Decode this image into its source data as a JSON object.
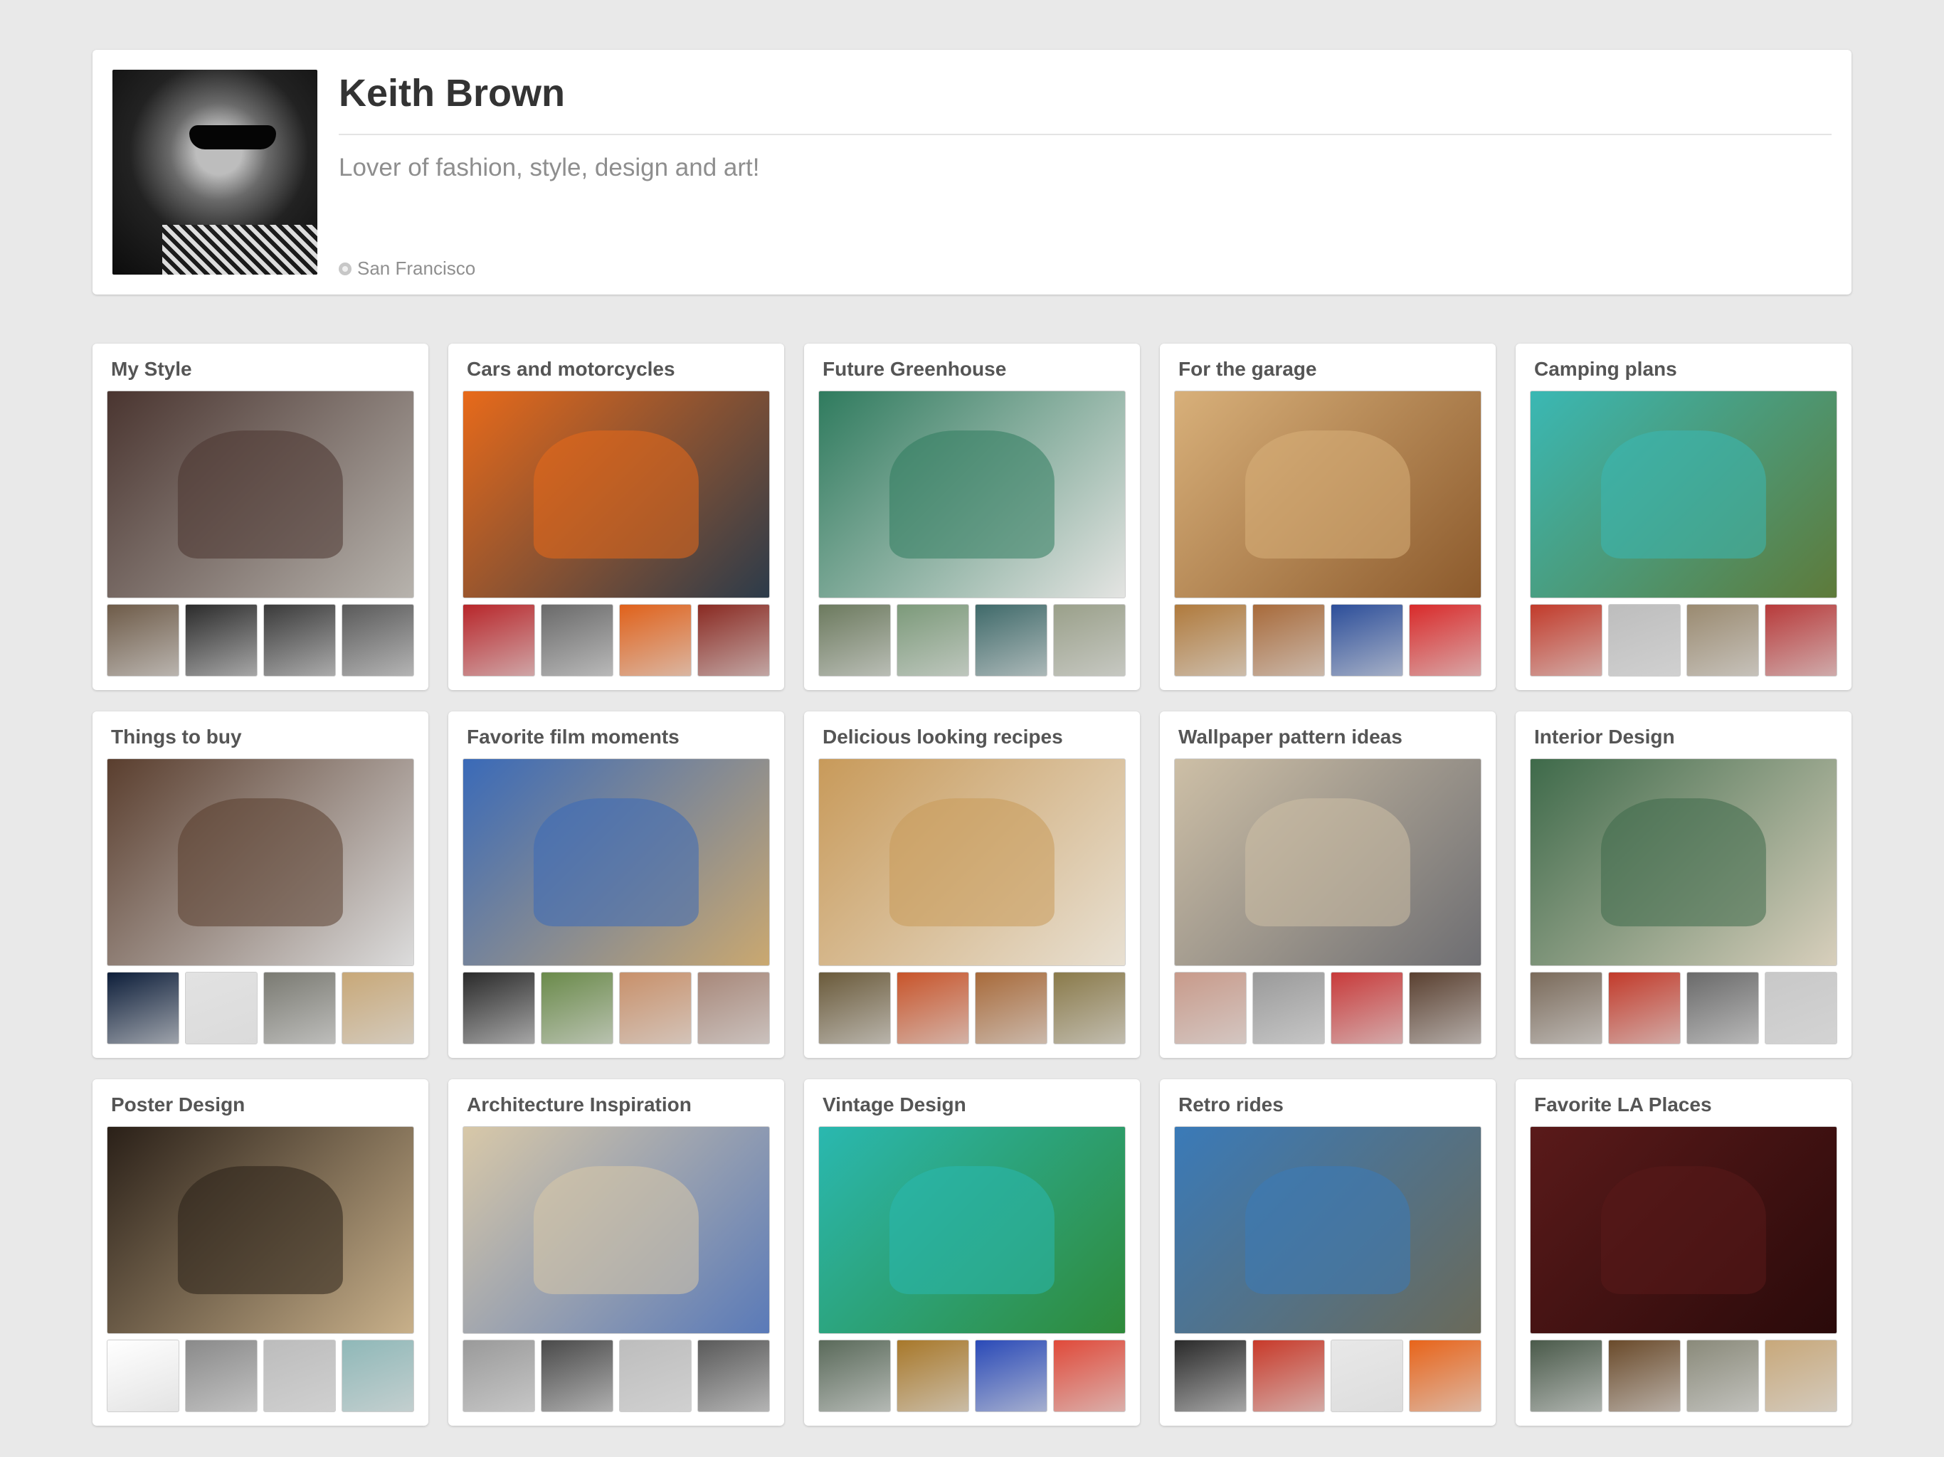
{
  "profile": {
    "name": "Keith Brown",
    "bio": "Lover of fashion, style, design and art!",
    "location": "San Francisco",
    "location_icon": "globe-icon"
  },
  "colors": {
    "page_background": "#e9e9e9",
    "card_background": "#ffffff",
    "title_text": "#333333",
    "muted_text": "#8e8e8e"
  },
  "boards": [
    {
      "title": "My Style",
      "cover_colors": [
        "#4a3530",
        "#b7b3ad"
      ],
      "thumbs": [
        "#6e5b48",
        "#2b2b2b",
        "#3a3a3a",
        "#5a5a5a"
      ]
    },
    {
      "title": "Cars and motorcycles",
      "cover_colors": [
        "#e86a1a",
        "#2c3b4a"
      ],
      "thumbs": [
        "#b8262a",
        "#6a6a6a",
        "#e0611a",
        "#8a2a22"
      ]
    },
    {
      "title": "Future Greenhouse",
      "cover_colors": [
        "#2f7b5e",
        "#e4e4e2"
      ],
      "thumbs": [
        "#6c7a5e",
        "#7c9a7a",
        "#3f6a6a",
        "#9aa08a"
      ]
    },
    {
      "title": "For the garage",
      "cover_colors": [
        "#d8b07a",
        "#8c5a2c"
      ],
      "thumbs": [
        "#b07a3c",
        "#a86a3a",
        "#2c4e9a",
        "#d92a2a"
      ]
    },
    {
      "title": "Camping plans",
      "cover_colors": [
        "#3ab8b4",
        "#5e7a3a"
      ],
      "thumbs": [
        "#c23a2a",
        "#bdbdbd",
        "#9a8a70",
        "#b83a3a"
      ]
    },
    {
      "title": "Things to buy",
      "cover_colors": [
        "#5a3e2e",
        "#dcdcdc"
      ],
      "thumbs": [
        "#0d1e3a",
        "#e2e2e2",
        "#7a7a72",
        "#c8a878"
      ]
    },
    {
      "title": "Favorite film moments",
      "cover_colors": [
        "#3a6ab8",
        "#caa870"
      ],
      "thumbs": [
        "#2a2a2a",
        "#6a8a4a",
        "#c8906a",
        "#a8887a"
      ]
    },
    {
      "title": "Delicious looking recipes",
      "cover_colors": [
        "#c89a5a",
        "#e8e0d2"
      ],
      "thumbs": [
        "#6a5a3a",
        "#c8542a",
        "#a86a3a",
        "#8a7a4a"
      ]
    },
    {
      "title": "Wallpaper pattern ideas",
      "cover_colors": [
        "#cdbfa6",
        "#6e6e72"
      ],
      "thumbs": [
        "#c89a8a",
        "#9a9a9a",
        "#c83a3a",
        "#5a4030"
      ]
    },
    {
      "title": "Interior Design",
      "cover_colors": [
        "#3e6a4a",
        "#d8cfbc"
      ],
      "thumbs": [
        "#7a6a5a",
        "#c23a2a",
        "#6a6a6a",
        "#c8c8c8"
      ]
    },
    {
      "title": "Poster Design",
      "cover_colors": [
        "#2a2018",
        "#c8b08a"
      ],
      "thumbs": [
        "#ffffff",
        "#8a8a8a",
        "#bcbcbc",
        "#8fb8b8"
      ]
    },
    {
      "title": "Architecture Inspiration",
      "cover_colors": [
        "#d8c8a8",
        "#5a7ab8"
      ],
      "thumbs": [
        "#9a9a9a",
        "#4a4a4a",
        "#bdbdbd",
        "#5a5a5a"
      ]
    },
    {
      "title": "Vintage Design",
      "cover_colors": [
        "#2ab8b0",
        "#2f8a3a"
      ],
      "thumbs": [
        "#5a6a5a",
        "#a8782a",
        "#2a4ab8",
        "#e04a3a"
      ]
    },
    {
      "title": "Retro rides",
      "cover_colors": [
        "#3a7ab8",
        "#6a6a5a"
      ],
      "thumbs": [
        "#2a2a2a",
        "#c83a2a",
        "#e8e8e8",
        "#e8641a"
      ]
    },
    {
      "title": "Favorite LA Places",
      "cover_colors": [
        "#5a1a1a",
        "#2a0a0a"
      ],
      "thumbs": [
        "#4a5a4a",
        "#6a4a2a",
        "#8a8a7a",
        "#c8a87a"
      ]
    }
  ]
}
